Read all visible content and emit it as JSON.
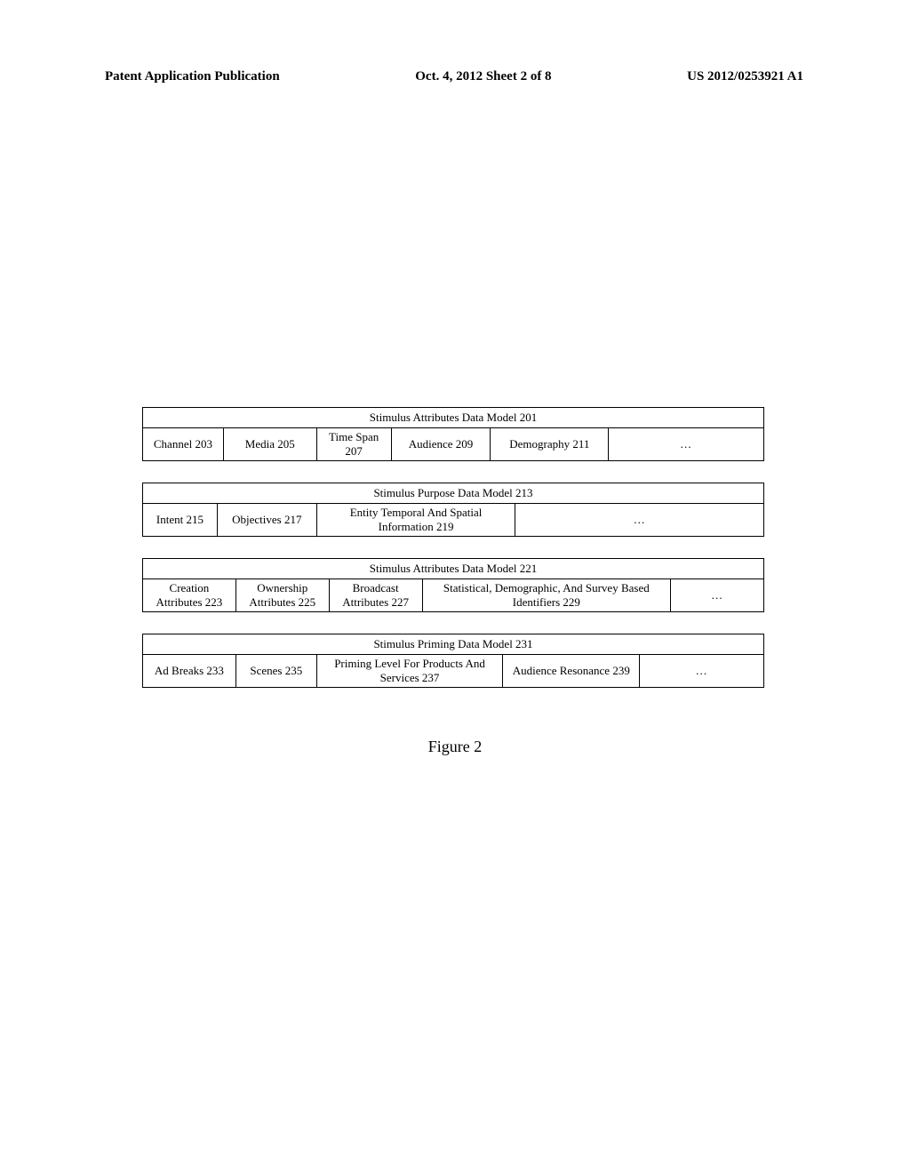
{
  "header": {
    "left": "Patent Application Publication",
    "center": "Oct. 4, 2012  Sheet 2 of 8",
    "right": "US 2012/0253921 A1"
  },
  "tables": {
    "t201": {
      "title": "Stimulus Attributes Data Model 201",
      "cells": [
        "Channel 203",
        "Media 205",
        "Time Span 207",
        "Audience 209",
        "Demography 211",
        "…"
      ]
    },
    "t213": {
      "title": "Stimulus Purpose Data Model 213",
      "cells": [
        "Intent 215",
        "Objectives 217",
        "Entity Temporal And Spatial Information 219",
        "…"
      ]
    },
    "t221": {
      "title": "Stimulus Attributes Data Model 221",
      "cells": [
        "Creation Attributes 223",
        "Ownership Attributes 225",
        "Broadcast Attributes 227",
        "Statistical, Demographic, And Survey Based Identifiers 229",
        "…"
      ]
    },
    "t231": {
      "title": "Stimulus Priming Data Model 231",
      "cells": [
        "Ad Breaks 233",
        "Scenes 235",
        "Priming Level For Products And Services 237",
        "Audience Resonance 239",
        "…"
      ]
    }
  },
  "figure_caption": "Figure 2"
}
